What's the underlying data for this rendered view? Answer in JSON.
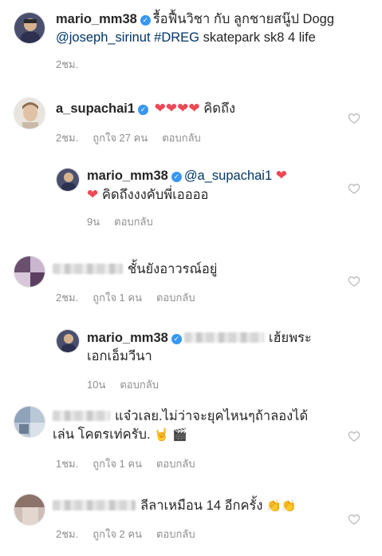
{
  "caption": {
    "username": "mario_mm38",
    "line1": "รื้อฟื้นวิชา กับ ลูกชายสนู๊ป Dogg",
    "mention": "@joseph_sirinut",
    "hashtag": "#DREG",
    "line2_rest": "skatepark sk8 4 life",
    "time": "2ชม."
  },
  "comments": [
    {
      "username": "a_supachai1",
      "hearts": "❤❤❤❤",
      "text": "คิดถึง",
      "time": "2ชม.",
      "likes": "ถูกใจ 27 คน",
      "reply": "ตอบกลับ"
    },
    {
      "username": "mario_mm38",
      "mention": "@a_supachai1",
      "heart1": "❤",
      "heart2": "❤",
      "text": "คิดถึงงงคับพี่เออออ",
      "time": "9น",
      "reply": "ตอบกลับ"
    },
    {
      "text": "ชั้นยังอาวรณ์อยู่",
      "time": "2ชม.",
      "likes": "ถูกใจ 1 คน",
      "reply": "ตอบกลับ"
    },
    {
      "username": "mario_mm38",
      "text1": "เฮ้ยพระ",
      "text2": "เอกเอ็มวีนา",
      "time": "10น",
      "reply": "ตอบกลับ"
    },
    {
      "text1": "แจ๋วเลย.ไม่ว่าจะยุคไหนๆถ้าลองได้",
      "text2": "เล่น โคตรเท่ครับ.",
      "emojis": "🤘 🎬",
      "time": "1ชม.",
      "likes": "ถูกใจ 1 คน",
      "reply": "ตอบกลับ"
    },
    {
      "text": "ลีลาเหมือน 14 อีกครั้ง",
      "emojis": "👏👏",
      "time": "2ชม.",
      "likes": "ถูกใจ 2 คน",
      "reply": "ตอบกลับ"
    }
  ],
  "icons": {
    "verified": "verified-badge-icon",
    "like": "heart-outline-icon"
  },
  "colors": {
    "verified": "#3897f0",
    "link": "#003569",
    "meta": "#8e8e8e",
    "heart": "#ed4956"
  }
}
